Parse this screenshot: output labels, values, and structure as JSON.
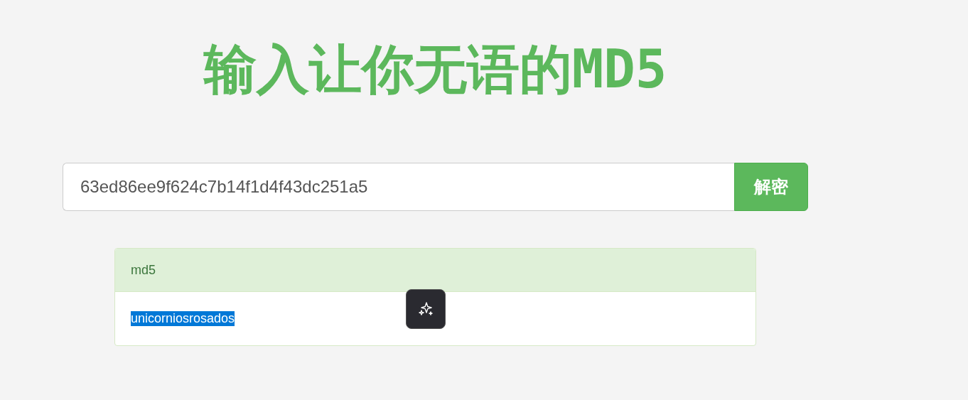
{
  "title": "输入让你无语的MD5",
  "search": {
    "value": "63ed86ee9f624c7b14f1d4f43dc251a5",
    "button": "解密"
  },
  "result": {
    "heading": "md5",
    "text": "unicorniosrosados",
    "selected": true
  },
  "floating_button": {
    "kind": "sparkle"
  }
}
